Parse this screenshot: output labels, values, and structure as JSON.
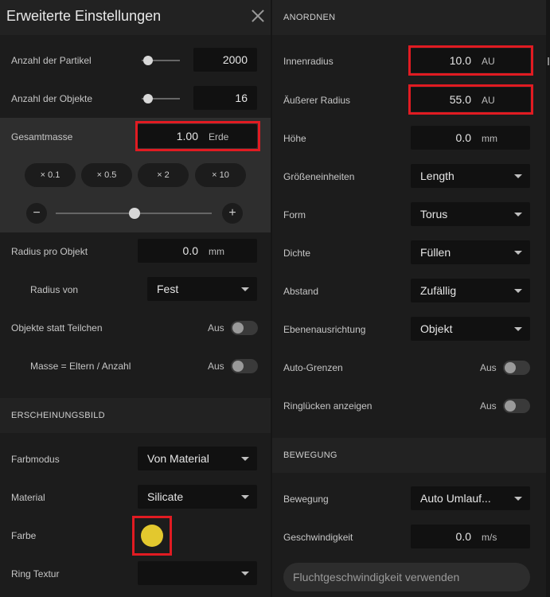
{
  "left": {
    "title": "Erweiterte Einstellungen",
    "particle_count": {
      "label": "Anzahl der Partikel",
      "value": "2000"
    },
    "object_count": {
      "label": "Anzahl der Objekte",
      "value": "16"
    },
    "total_mass": {
      "label": "Gesamtmasse",
      "value": "1.00",
      "unit": "Erde",
      "multipliers": [
        "× 0.1",
        "× 0.5",
        "× 2",
        "× 10"
      ],
      "minus": "−",
      "plus": "+"
    },
    "radius_per_object": {
      "label": "Radius pro Objekt",
      "value": "0.0",
      "unit": "mm"
    },
    "radius_from": {
      "label": "Radius von",
      "value": "Fest"
    },
    "objects_instead_particles": {
      "label": "Objekte statt Teilchen",
      "state": "Aus"
    },
    "mass_parent_count": {
      "label": "Masse = Eltern / Anzahl",
      "state": "Aus"
    },
    "appearance": {
      "section": "ERSCHEINUNGSBILD",
      "color_mode": {
        "label": "Farbmodus",
        "value": "Von Material"
      },
      "material": {
        "label": "Material",
        "value": "Silicate"
      },
      "color": {
        "label": "Farbe",
        "hex": "#e3c82e"
      },
      "ring_texture": {
        "label": "Ring Textur",
        "value": ""
      }
    }
  },
  "right": {
    "arrange": {
      "section": "ANORDNEN",
      "inner_radius": {
        "label": "Innenradius",
        "value": "10.0",
        "unit": "AU"
      },
      "outer_radius": {
        "label": "Äußerer Radius",
        "value": "55.0",
        "unit": "AU"
      },
      "height": {
        "label": "Höhe",
        "value": "0.0",
        "unit": "mm"
      },
      "size_units": {
        "label": "Größeneinheiten",
        "value": "Length"
      },
      "shape": {
        "label": "Form",
        "value": "Torus"
      },
      "density": {
        "label": "Dichte",
        "value": "Füllen"
      },
      "spacing": {
        "label": "Abstand",
        "value": "Zufällig"
      },
      "plane_alignment": {
        "label": "Ebenenausrichtung",
        "value": "Objekt"
      },
      "auto_bounds": {
        "label": "Auto-Grenzen",
        "state": "Aus"
      },
      "show_ring_gaps": {
        "label": "Ringlücken anzeigen",
        "state": "Aus"
      }
    },
    "motion": {
      "section": "BEWEGUNG",
      "motion": {
        "label": "Bewegung",
        "value": "Auto Umlauf..."
      },
      "speed": {
        "label": "Geschwindigkeit",
        "value": "0.0",
        "unit": "m/s"
      },
      "escape_button": "Fluchtgeschwindigkeit verwenden"
    }
  },
  "colors": {
    "highlight": "#e11b22",
    "panel": "#1c1c1c",
    "field": "#111111",
    "swatch": "#e3c82e"
  }
}
